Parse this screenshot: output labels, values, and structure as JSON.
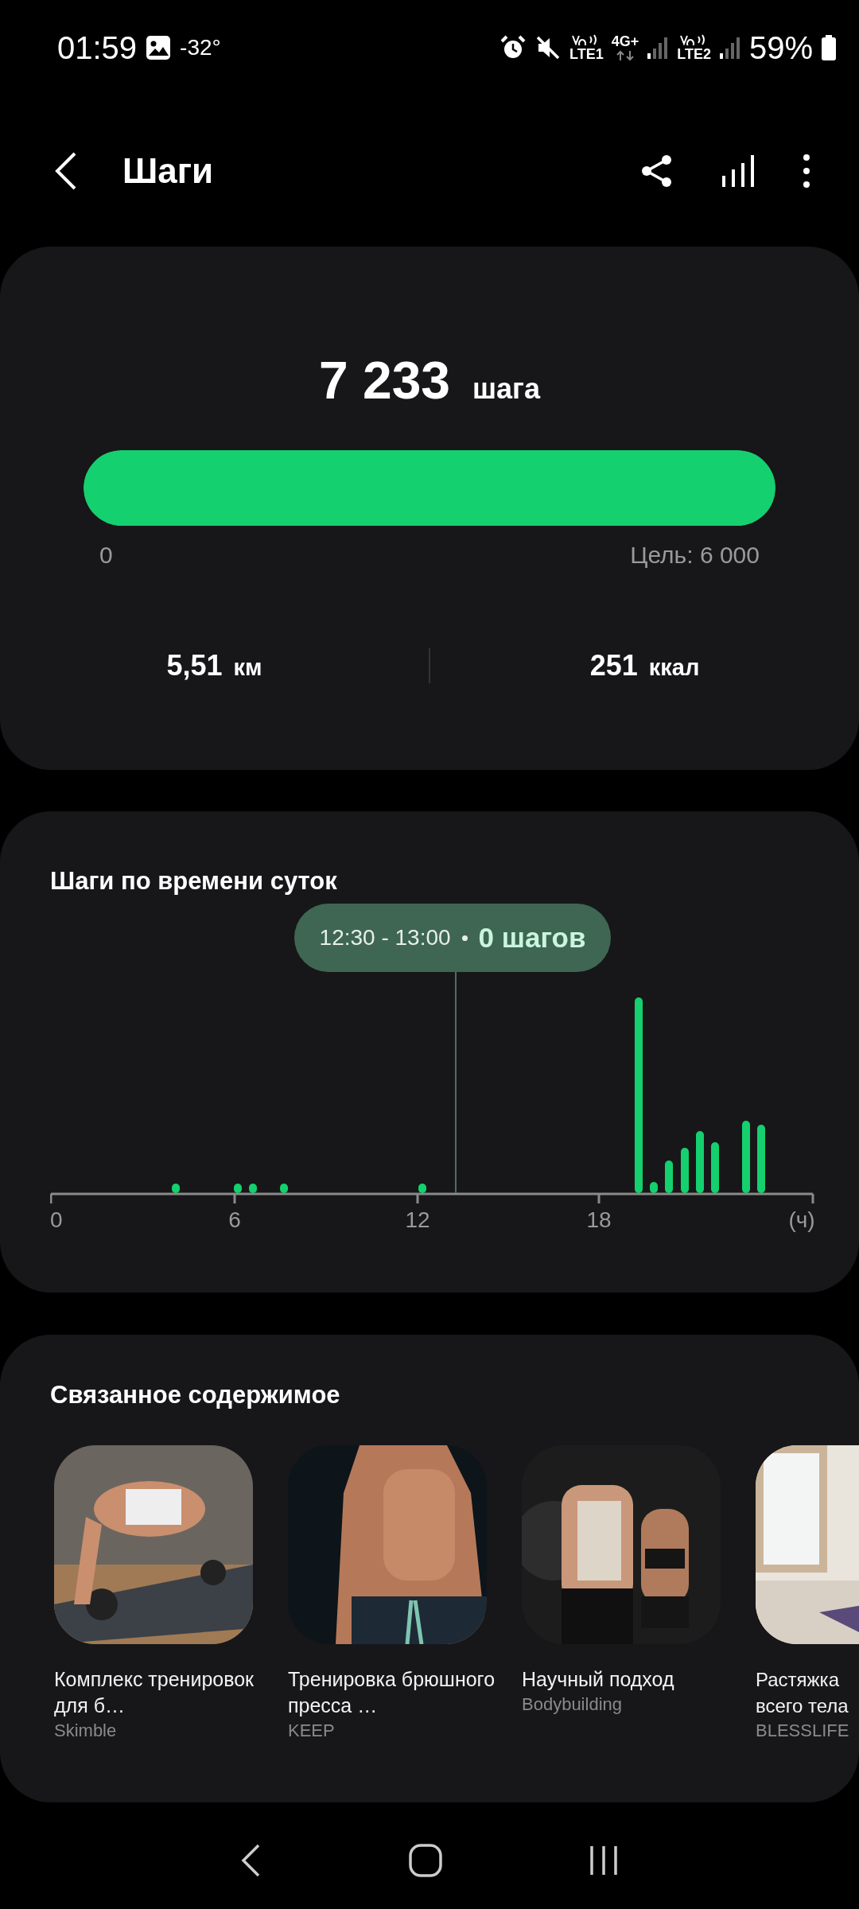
{
  "status_bar": {
    "time": "01:59",
    "temperature": "-32°",
    "sim1": "LTE1",
    "network": "4G+",
    "sim2": "LTE2",
    "battery": "59%"
  },
  "header": {
    "title": "Шаги"
  },
  "summary": {
    "steps": "7 233",
    "steps_unit": "шага",
    "level": 1,
    "start_label": "0",
    "goal_label": "Цель: 6 000",
    "stats": [
      {
        "value": "5,51",
        "unit": "км"
      },
      {
        "value": "251",
        "unit": "ккал"
      }
    ]
  },
  "hourly": {
    "title": "Шаги по времени суток",
    "tooltip": {
      "time": "12:30 - 13:00",
      "steps": "0 шагов"
    },
    "axis_labels": [
      "0",
      "6",
      "12",
      "18",
      "(ч)"
    ]
  },
  "related": {
    "title": "Связанное содержимое",
    "items": [
      {
        "title": "Комплекс тренировок для б…",
        "source": "Skimble",
        "kind": "picture"
      },
      {
        "title": "Тренировка брюшного пресса …",
        "source": "KEEP",
        "kind": "picture"
      },
      {
        "title": "Научный подход",
        "source": "Bodybuilding",
        "kind": "picture"
      },
      {
        "title": "Растяжка всего тела",
        "source": "BLESSLIFE",
        "kind": "picture"
      }
    ]
  }
}
